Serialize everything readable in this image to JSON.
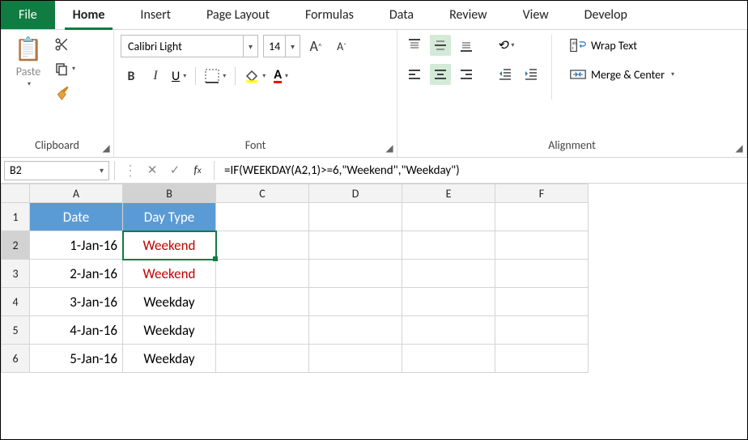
{
  "tabs": {
    "file": "File",
    "home": "Home",
    "insert": "Insert",
    "pageLayout": "Page Layout",
    "formulas": "Formulas",
    "data": "Data",
    "review": "Review",
    "view": "View",
    "developer": "Develop"
  },
  "ribbon": {
    "clipboard": {
      "label": "Clipboard",
      "paste": "Paste"
    },
    "font": {
      "label": "Font",
      "name": "Calibri Light",
      "size": "14",
      "bold": "B",
      "italic": "I",
      "underline": "U",
      "increaseA": "A",
      "decreaseA": "A"
    },
    "alignment": {
      "label": "Alignment",
      "wrap": "Wrap Text",
      "merge": "Merge & Center"
    }
  },
  "formulaBar": {
    "nameBox": "B2",
    "formula": "=IF(WEEKDAY(A2,1)>=6,\"Weekend\",\"Weekday\")"
  },
  "columns": [
    "A",
    "B",
    "C",
    "D",
    "E",
    "F"
  ],
  "rows": [
    {
      "n": "1",
      "cells": [
        {
          "v": "Date",
          "hdr": true
        },
        {
          "v": "Day Type",
          "hdr": true
        },
        {
          "v": ""
        },
        {
          "v": ""
        },
        {
          "v": ""
        },
        {
          "v": ""
        }
      ]
    },
    {
      "n": "2",
      "sel": true,
      "cells": [
        {
          "v": "1-Jan-16",
          "align": "r"
        },
        {
          "v": "Weekend",
          "align": "c",
          "red": true,
          "sel": true
        },
        {
          "v": ""
        },
        {
          "v": ""
        },
        {
          "v": ""
        },
        {
          "v": ""
        }
      ]
    },
    {
      "n": "3",
      "cells": [
        {
          "v": "2-Jan-16",
          "align": "r"
        },
        {
          "v": "Weekend",
          "align": "c",
          "red": true
        },
        {
          "v": ""
        },
        {
          "v": ""
        },
        {
          "v": ""
        },
        {
          "v": ""
        }
      ]
    },
    {
      "n": "4",
      "cells": [
        {
          "v": "3-Jan-16",
          "align": "r"
        },
        {
          "v": "Weekday",
          "align": "c"
        },
        {
          "v": ""
        },
        {
          "v": ""
        },
        {
          "v": ""
        },
        {
          "v": ""
        }
      ]
    },
    {
      "n": "5",
      "cells": [
        {
          "v": "4-Jan-16",
          "align": "r"
        },
        {
          "v": "Weekday",
          "align": "c"
        },
        {
          "v": ""
        },
        {
          "v": ""
        },
        {
          "v": ""
        },
        {
          "v": ""
        }
      ]
    },
    {
      "n": "6",
      "cells": [
        {
          "v": "5-Jan-16",
          "align": "r"
        },
        {
          "v": "Weekday",
          "align": "c"
        },
        {
          "v": ""
        },
        {
          "v": ""
        },
        {
          "v": ""
        },
        {
          "v": ""
        }
      ]
    }
  ]
}
